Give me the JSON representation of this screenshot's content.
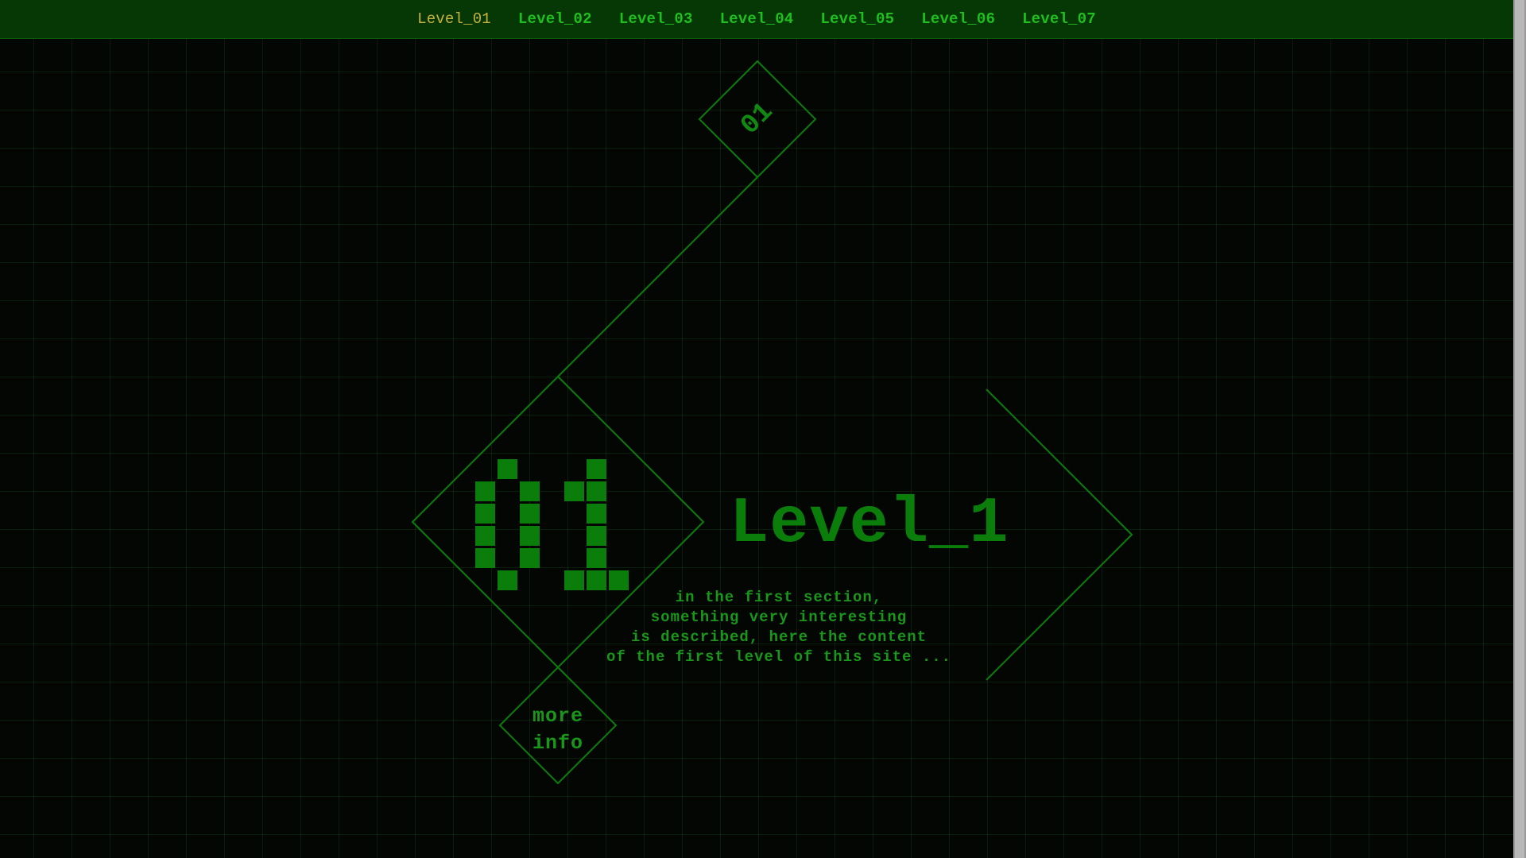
{
  "nav": {
    "items": [
      {
        "label": "Level_01",
        "active": true
      },
      {
        "label": "Level_02",
        "active": false
      },
      {
        "label": "Level_03",
        "active": false
      },
      {
        "label": "Level_04",
        "active": false
      },
      {
        "label": "Level_05",
        "active": false
      },
      {
        "label": "Level_06",
        "active": false
      },
      {
        "label": "Level_07",
        "active": false
      }
    ]
  },
  "section": {
    "badge_number": "01",
    "title": "Level_1",
    "description": "in the first section,\nsomething very interesting\nis described, here the content\nof the first level of this site ...",
    "more_info_label": "more\ninfo"
  },
  "colors": {
    "background": "#030603",
    "grid": "#1c4a1c",
    "navbar": "#053805",
    "nav_text": "#1fbf1f",
    "nav_active": "#c7b23a",
    "accent": "#0b7d0b"
  },
  "icons": {
    "pixel_number": "pixel-digits-01-icon",
    "arrow": "chevron-right-icon"
  }
}
